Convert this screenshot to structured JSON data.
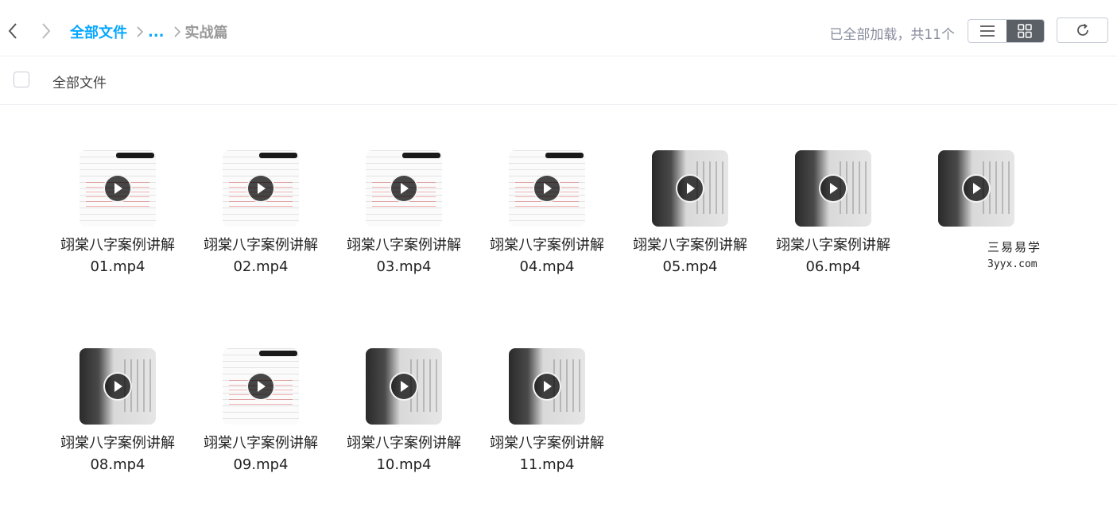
{
  "breadcrumb": {
    "root": "全部文件",
    "ellipsis": "...",
    "current": "实战篇"
  },
  "status": "已全部加载，共11个",
  "select_label": "全部文件",
  "view_mode": "grid",
  "colors": {
    "accent": "#06a7ff",
    "active_toggle": "#5b5f66"
  },
  "files": [
    {
      "name": "翊棠八字案例讲解01.mp4",
      "thumb": "doc"
    },
    {
      "name": "翊棠八字案例讲解02.mp4",
      "thumb": "doc"
    },
    {
      "name": "翊棠八字案例讲解03.mp4",
      "thumb": "doc"
    },
    {
      "name": "翊棠八字案例讲解04.mp4",
      "thumb": "doc"
    },
    {
      "name": "翊棠八字案例讲解05.mp4",
      "thumb": "video"
    },
    {
      "name": "翊棠八字案例讲解06.mp4",
      "thumb": "video"
    },
    {
      "name": "",
      "thumb": "video"
    },
    {
      "name": "翊棠八字案例讲解08.mp4",
      "thumb": "video"
    },
    {
      "name": "翊棠八字案例讲解09.mp4",
      "thumb": "doc"
    },
    {
      "name": "翊棠八字案例讲解10.mp4",
      "thumb": "video"
    },
    {
      "name": "翊棠八字案例讲解11.mp4",
      "thumb": "video"
    }
  ],
  "watermark": {
    "cn": "三易易学",
    "en": "3yyx.com"
  }
}
